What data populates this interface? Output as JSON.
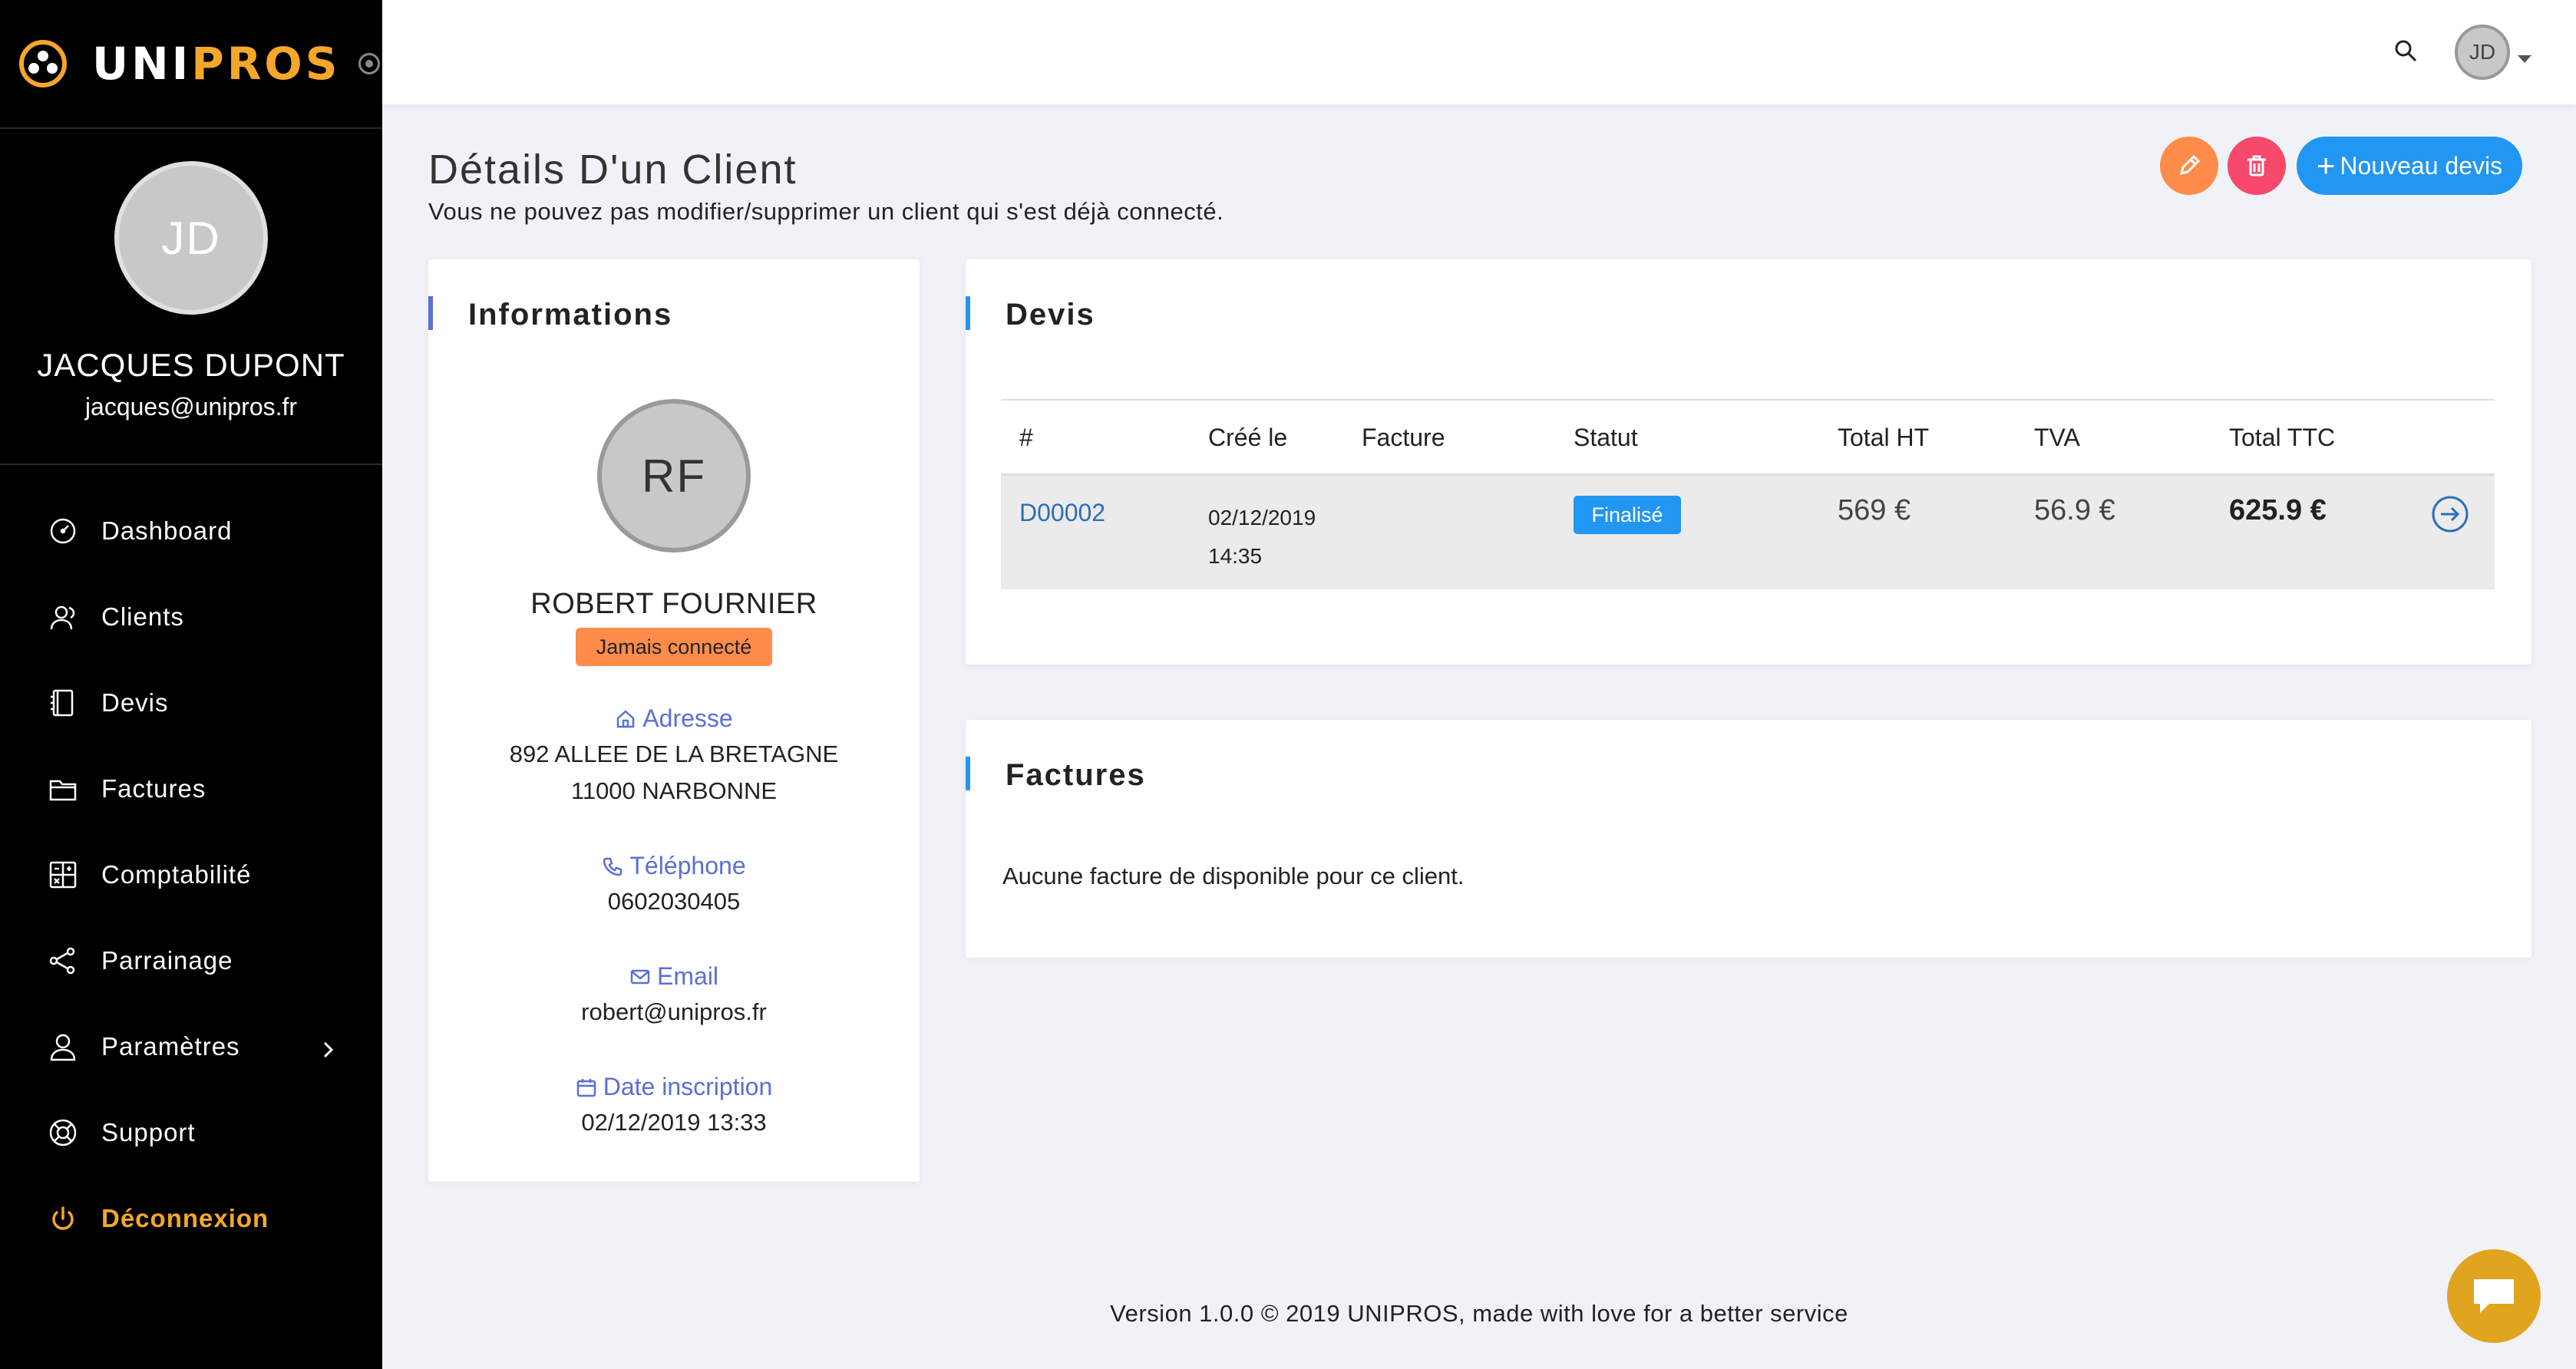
{
  "brand": {
    "name_prefix": "UNI",
    "name_accent": "PROS"
  },
  "profile": {
    "initials": "JD",
    "name": "JACQUES DUPONT",
    "email": "jacques@unipros.fr"
  },
  "nav": [
    {
      "label": "Dashboard",
      "icon": "dashboard-icon"
    },
    {
      "label": "Clients",
      "icon": "clients-icon"
    },
    {
      "label": "Devis",
      "icon": "devis-icon"
    },
    {
      "label": "Factures",
      "icon": "factures-icon"
    },
    {
      "label": "Comptabilité",
      "icon": "calculator-icon"
    },
    {
      "label": "Parrainage",
      "icon": "share-icon"
    },
    {
      "label": "Paramètres",
      "icon": "user-settings-icon"
    },
    {
      "label": "Support",
      "icon": "lifebuoy-icon"
    },
    {
      "label": "Déconnexion",
      "icon": "power-icon"
    }
  ],
  "topbar": {
    "avatar_initials": "JD"
  },
  "page": {
    "title": "Détails D'un Client",
    "subtitle": "Vous ne pouvez pas modifier/supprimer un client qui s'est déjà connecté.",
    "new_button": "Nouveau devis"
  },
  "info": {
    "title": "Informations",
    "initials": "RF",
    "name": "ROBERT FOURNIER",
    "status_badge": "Jamais connecté",
    "address_label": "Adresse",
    "address_line1": "892 ALLEE DE LA BRETAGNE",
    "address_line2": "11000 NARBONNE",
    "phone_label": "Téléphone",
    "phone": "0602030405",
    "email_label": "Email",
    "email": "robert@unipros.fr",
    "date_label": "Date inscription",
    "date": "02/12/2019 13:33"
  },
  "devis": {
    "title": "Devis",
    "headers": [
      "#",
      "Créé le",
      "Facture",
      "Statut",
      "Total HT",
      "TVA",
      "Total TTC"
    ],
    "rows": [
      {
        "ref": "D00002",
        "date": "02/12/2019",
        "time": "14:35",
        "facture": "",
        "status": "Finalisé",
        "total_ht": "569 €",
        "tva": "56.9 €",
        "total_ttc": "625.9 €"
      }
    ]
  },
  "factures": {
    "title": "Factures",
    "empty": "Aucune facture de disponible pour ce client."
  },
  "footer": "Version 1.0.0 © 2019 UNIPROS, made with love for a better service",
  "colors": {
    "accent": "#f4a72a",
    "primary": "#2196f3",
    "edit": "#ff8c4a",
    "delete": "#f6496b",
    "label": "#5b6fd6"
  }
}
